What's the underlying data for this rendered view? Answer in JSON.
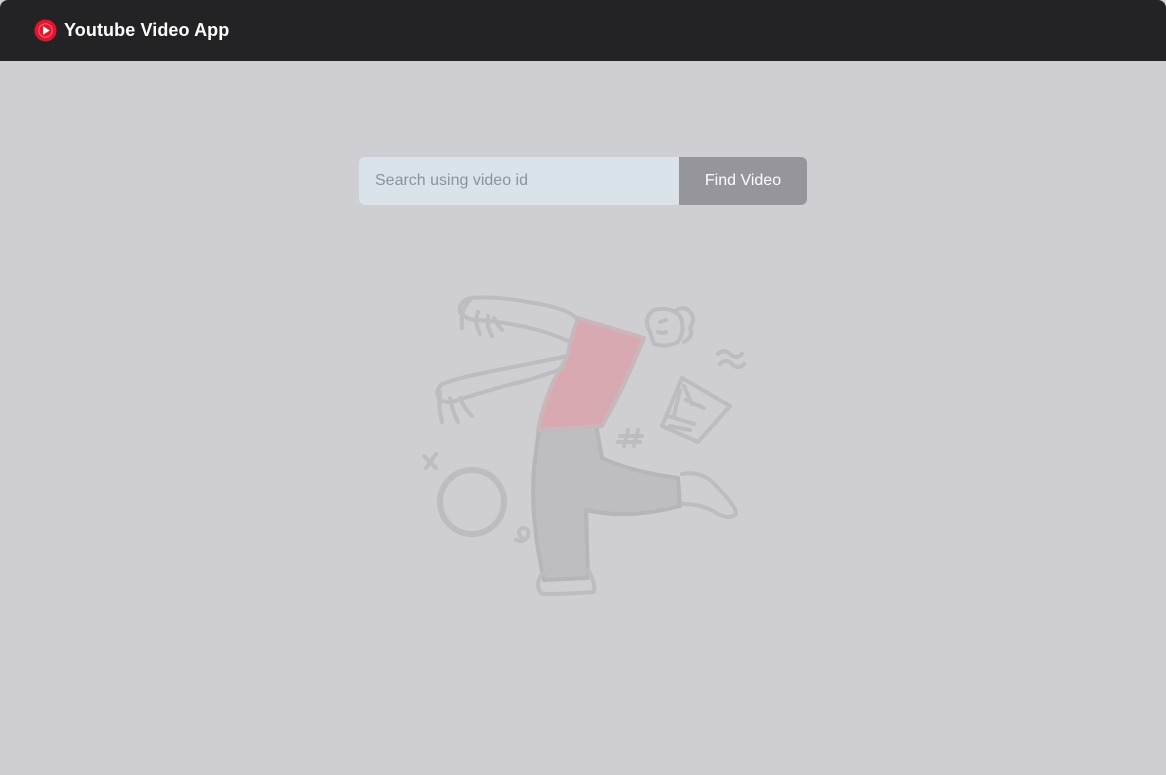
{
  "navbar": {
    "app_title": "Youtube Video App",
    "logo_icon": "youtube-play-icon",
    "logo_color": "#e5142b",
    "background": "#232326"
  },
  "search": {
    "placeholder": "Search using video id",
    "value": "",
    "button_label": "Find Video"
  },
  "empty_state": {
    "illustration": "person-kicking-shapes-illustration",
    "accent_color": "#d9a9b1"
  }
}
